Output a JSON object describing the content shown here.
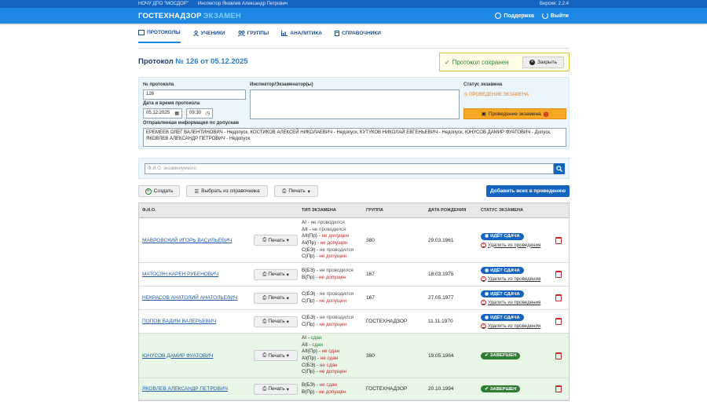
{
  "topbar": {
    "org": "НОЧУ ДПО \"МОСДОР\"",
    "inspector": "Инспектор Яковлев Александр Петрович",
    "version": "Версия: 2.2.4"
  },
  "brand": {
    "name": "ГОСТЕХНАДЗОР",
    "sub": "ЭКЗАМЕН",
    "support": "Поддержка",
    "logout": "Выйти"
  },
  "nav": [
    "ПРОТОКОЛЫ",
    "УЧЕНИКИ",
    "ГРУППЫ",
    "АНАЛИТИКА",
    "СПРАВОЧНИКИ"
  ],
  "title": {
    "prefix": "Протокол",
    "num": "№ 126 от 05.12.2025"
  },
  "saved": {
    "text": "Протокол сохранен",
    "close": "Закрыть"
  },
  "form": {
    "num_label": "№ протокола",
    "num_value": "126",
    "dt_label": "Дата и время протокола",
    "date": "05.12.2025",
    "time": "09:30",
    "insp_label": "Инспектор/Экзаменатор(ы)",
    "status_label": "Статус экзамена",
    "status_value": "ПРОВЕДЕНИЕ ЭКЗАМЕНА",
    "run_btn": "Проведение экзамена",
    "sent_label": "Отправленная информация по допускам",
    "sent_text": "ЕРЕМЕЕВ ОЛЕГ ВАЛЕНТИНОВИЧ - Недопуск, КОСТИКОВ АЛЕКСЕЙ НИКОЛАЕВИЧ - Недопуск, КУТУКОВ НИКОЛАЙ ЕВГЕНЬЕВИЧ - Недопуск, ЮНУСОВ ДАМИР ФУАТОВИЧ - Допуск, ЯКОВЛЕВ АЛЕКСАНДР ПЕТРОВИЧ - Недопуск"
  },
  "search": {
    "placeholder": "Ф.И.О. экзаменуемого"
  },
  "toolbar": {
    "create": "Создать",
    "pick": "Выбрать из справочника",
    "print": "Печать",
    "add_all": "Добавить всех в проведению"
  },
  "table": {
    "headers": [
      "Ф.И.О.",
      "ТИП ЭКЗАМЕНА",
      "ГРУППА",
      "ДАТА РОЖДЕНИЯ",
      "СТАТУС ЭКЗАМЕНА"
    ],
    "print": "Печать",
    "rows": [
      {
        "name": "МАВРОВСКИЙ ИГОРЬ ВАСИЛЬЕВИЧ",
        "group": "380",
        "dob": "29.03.1961",
        "status": "ИДЁТ СДАЧА",
        "remove": "Удалить из проведения",
        "done": false,
        "exams": [
          [
            "AI",
            "не проводился",
            "no"
          ],
          [
            "AII",
            "не проводился",
            "no"
          ],
          [
            "AII(Пр)",
            "не допущен",
            "bad"
          ],
          [
            "AI(Пр)",
            "не допущен",
            "bad"
          ],
          [
            "C(БЭ)",
            "не проводился",
            "no"
          ],
          [
            "C(Пр)",
            "не допущен",
            "bad"
          ]
        ]
      },
      {
        "name": "МАТОСЯН КАРЕН РУБЕНОВИЧ",
        "group": "167",
        "dob": "18.03.1975",
        "status": "ИДЁТ СДАЧА",
        "remove": "Удалить из проведения",
        "done": false,
        "exams": [
          [
            "B(БЭ)",
            "не проводился",
            "no"
          ],
          [
            "B(Пр)",
            "не допущен",
            "bad"
          ]
        ]
      },
      {
        "name": "НЕКРАСОВ АНАТОЛИЙ АНАТОЛЬЕВИЧ",
        "group": "167",
        "dob": "27.05.1977",
        "status": "ИДЁТ СДАЧА",
        "remove": "Удалить из проведения",
        "done": false,
        "exams": [
          [
            "C(БЭ)",
            "не проводился",
            "no"
          ],
          [
            "C(Пр)",
            "не допущен",
            "bad"
          ]
        ]
      },
      {
        "name": "ПОПОВ ВАДИМ ВАЛЕРЬЕВИЧ",
        "group": "ГОСТЕХНАДЗОР",
        "dob": "11.11.1970",
        "status": "ИДЁТ СДАЧА",
        "remove": "Удалить из проведения",
        "done": false,
        "exams": [
          [
            "C(БЭ)",
            "не проводился",
            "no"
          ],
          [
            "C(Пр)",
            "не допущен",
            "bad"
          ]
        ]
      },
      {
        "name": "ЮНУСОВ ДАМИР ФУАТОВИЧ",
        "group": "380",
        "dob": "19.05.1964",
        "status": "ЗАВЕРШЕН",
        "remove": "",
        "done": true,
        "exams": [
          [
            "AI",
            "сдан",
            "ok"
          ],
          [
            "AII",
            "сдан",
            "ok"
          ],
          [
            "AII(Пр)",
            "не сдан",
            "bad"
          ],
          [
            "AI(Пр)",
            "не сдан",
            "bad"
          ],
          [
            "C(БЭ)",
            "не сдан",
            "bad"
          ],
          [
            "C(Пр)",
            "не допущен",
            "bad"
          ]
        ]
      },
      {
        "name": "ЯКОВЛЕВ АЛЕКСАНДР ПЕТРОВИЧ",
        "group": "ГОСТЕХНАДЗОР",
        "dob": "20.10.1994",
        "status": "ЗАВЕРШЕН",
        "remove": "",
        "done": true,
        "exams": [
          [
            "B(БЭ)",
            "не сдан",
            "bad"
          ],
          [
            "B(Пр)",
            "не допущен",
            "bad"
          ]
        ]
      }
    ]
  }
}
